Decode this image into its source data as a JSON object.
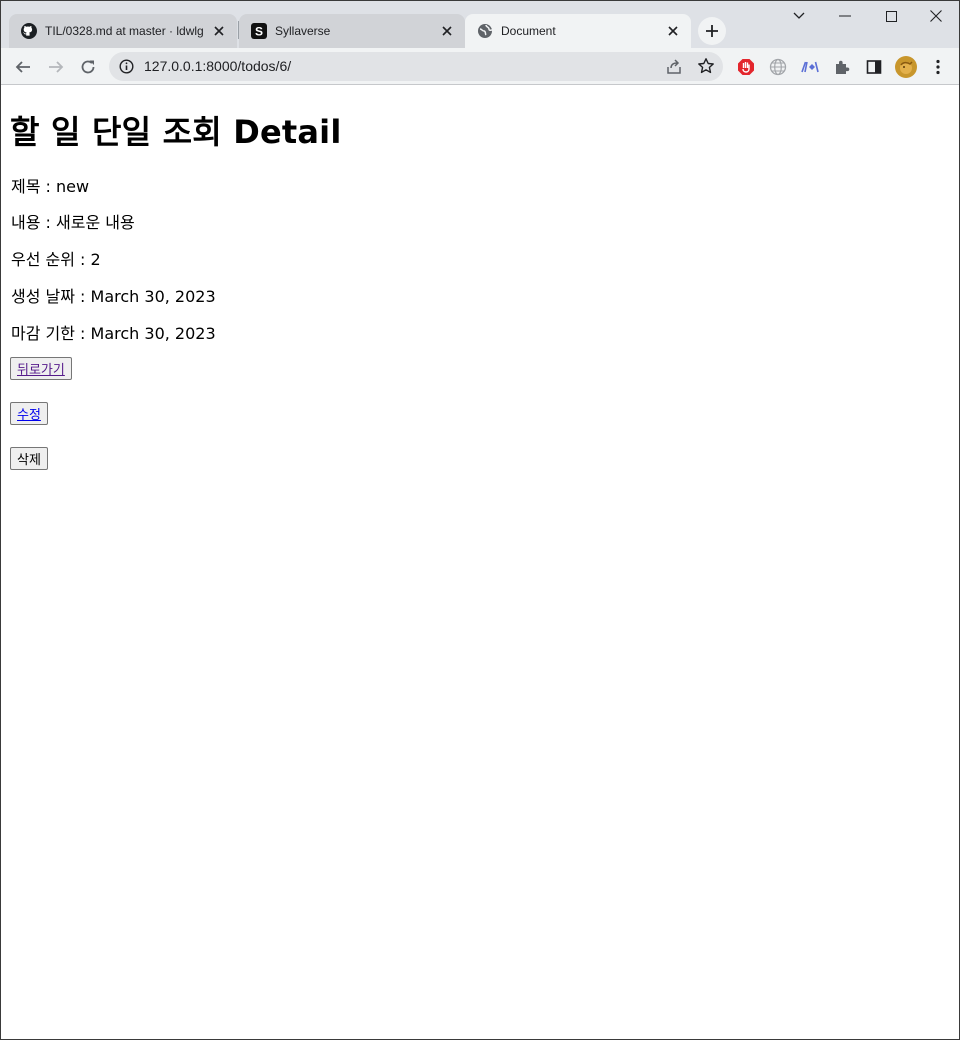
{
  "browser": {
    "tabs": [
      {
        "title": "TIL/0328.md at master · ldwlg",
        "icon": "github-icon",
        "active": false
      },
      {
        "title": "Syllaverse",
        "icon": "syllaverse-icon",
        "active": false
      },
      {
        "title": "Document",
        "icon": "globe-icon",
        "active": true
      }
    ],
    "address": "127.0.0.1:8000/todos/6/",
    "colors": {
      "tabstrip": "#dee1e6",
      "toolbar": "#f1f3f4",
      "link": "#0000ee",
      "visited_link": "#551a8b"
    }
  },
  "page": {
    "heading": "할 일 단일 조회 Detail",
    "fields": [
      {
        "text": "제목 : new"
      },
      {
        "text": "내용 : 새로운 내용"
      },
      {
        "text": "우선 순위 : 2"
      },
      {
        "text": "생성 날짜 : March 30, 2023"
      },
      {
        "text": "마감 기한 : March 30, 2023"
      }
    ],
    "buttons": {
      "back": "뒤로가기",
      "edit": "수정",
      "delete": "삭제"
    }
  }
}
